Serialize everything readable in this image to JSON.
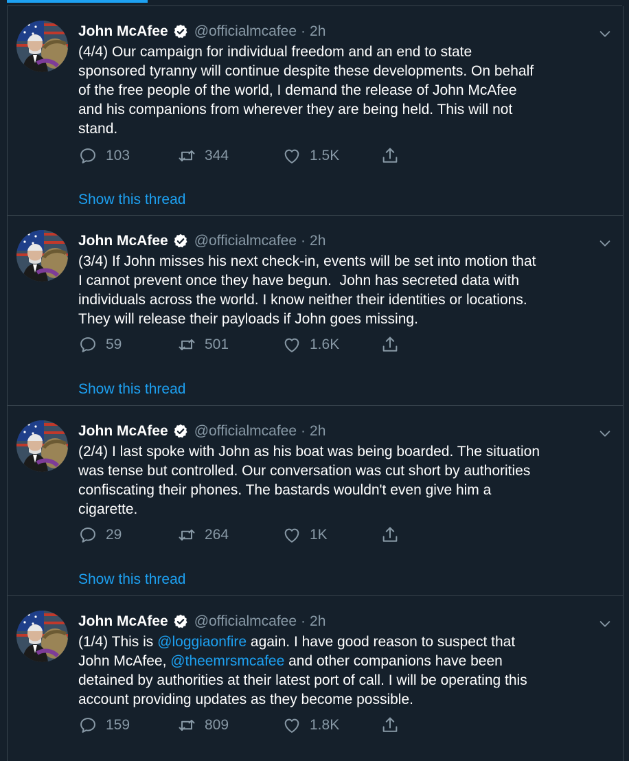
{
  "colors": {
    "background": "#15202b",
    "divider": "#38444d",
    "accent": "#1da1f2",
    "secondary_text": "#8899a6",
    "primary_text": "#ffffff"
  },
  "tweets": [
    {
      "name": "John McAfee",
      "handle": "@officialmcafee",
      "sep": "·",
      "time": "2h",
      "text_parts": [
        {
          "type": "text",
          "value": "(4/4) Our campaign for individual freedom and an end to state\nsponsored tyranny will continue despite these developments. On behalf\nof the free people of the world, I demand the release of John McAfee\nand his companions from wherever they are being held. This will not\nstand."
        }
      ],
      "replies": "103",
      "retweets": "344",
      "likes": "1.5K",
      "show_thread": "Show this thread"
    },
    {
      "name": "John McAfee",
      "handle": "@officialmcafee",
      "sep": "·",
      "time": "2h",
      "text_parts": [
        {
          "type": "text",
          "value": "(3/4) If John misses his next check-in, events will be set into motion that\nI cannot prevent once they have begun.  John has secreted data with\nindividuals across the world. I know neither their identities or locations.\nThey will release their payloads if John goes missing."
        }
      ],
      "replies": "59",
      "retweets": "501",
      "likes": "1.6K",
      "show_thread": "Show this thread"
    },
    {
      "name": "John McAfee",
      "handle": "@officialmcafee",
      "sep": "·",
      "time": "2h",
      "text_parts": [
        {
          "type": "text",
          "value": "(2/4) I last spoke with John as his boat was being boarded. The situation\nwas tense but controlled. Our conversation was cut short by authorities\nconfiscating their phones. The bastards wouldn't even give him a\ncigarette."
        }
      ],
      "replies": "29",
      "retweets": "264",
      "likes": "1K",
      "show_thread": "Show this thread"
    },
    {
      "name": "John McAfee",
      "handle": "@officialmcafee",
      "sep": "·",
      "time": "2h",
      "text_parts": [
        {
          "type": "text",
          "value": "(1/4) This is "
        },
        {
          "type": "mention",
          "value": "@loggiaonfire"
        },
        {
          "type": "text",
          "value": " again. I have good reason to suspect that\nJohn McAfee, "
        },
        {
          "type": "mention",
          "value": "@theemrsmcafee"
        },
        {
          "type": "text",
          "value": " and other companions have been\ndetained by authorities at their latest port of call. I will be operating this\naccount providing updates as they become possible."
        }
      ],
      "replies": "159",
      "retweets": "809",
      "likes": "1.8K"
    }
  ],
  "icons": {
    "verified": "verified-badge-icon",
    "caret": "chevron-down-icon",
    "reply": "reply-icon",
    "retweet": "retweet-icon",
    "like": "heart-icon",
    "share": "share-icon"
  }
}
